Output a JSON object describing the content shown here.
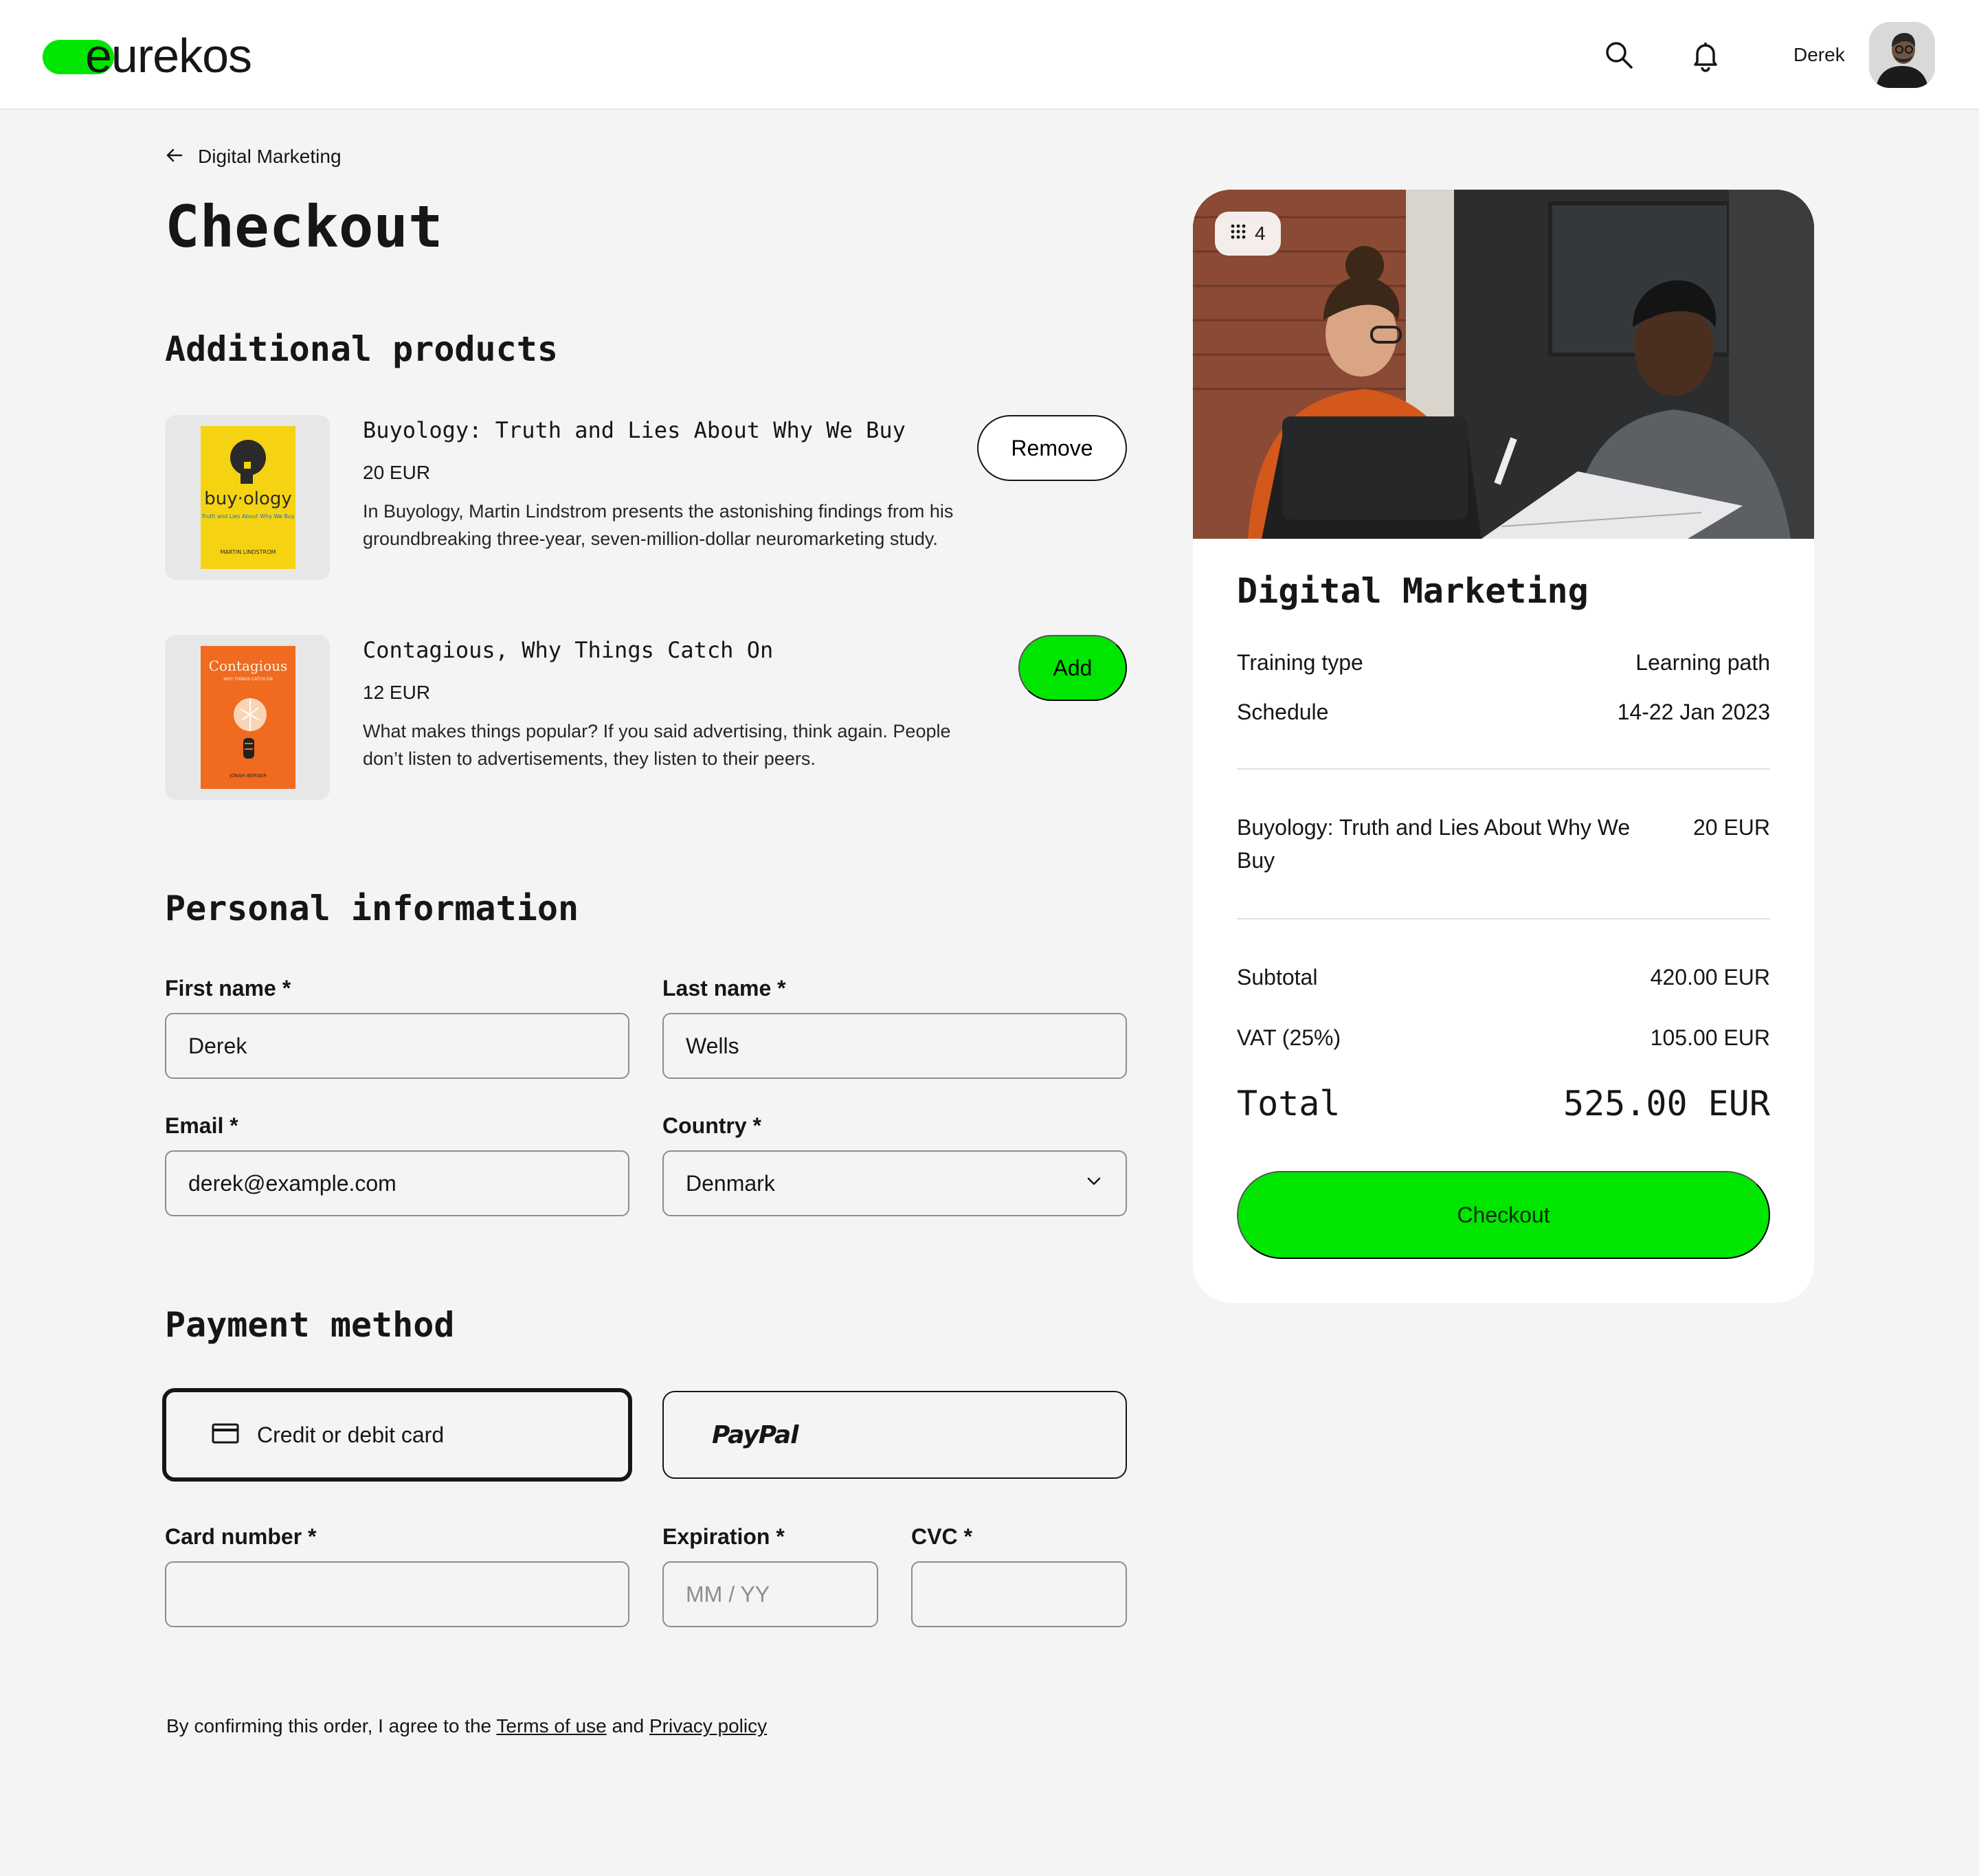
{
  "header": {
    "logo_text": "eurekos",
    "user_name": "Derek",
    "icons": [
      "search-icon",
      "bell-icon"
    ]
  },
  "breadcrumb": {
    "back_label": "Digital Marketing"
  },
  "page_title": "Checkout",
  "additional_products": {
    "title": "Additional products",
    "items": [
      {
        "name": "Buyology: Truth and Lies About Why We Buy",
        "price": "20 EUR",
        "description": "In Buyology, Martin Lindstrom presents the astonishing findings from his groundbreaking three-year, seven-million-dollar neuromarketing study.",
        "action": "Remove",
        "cover": {
          "title": "buy·ology",
          "subtitle": "Truth and Lies About Why We Buy",
          "author": "MARTIN LINDSTROM",
          "color": "#f5d313"
        }
      },
      {
        "name": "Contagious, Why Things Catch On",
        "price": "12 EUR",
        "description": "What makes things popular? If you said advertising, think again. People don’t listen to advertisements, they listen to their peers.",
        "action": "Add",
        "cover": {
          "title": "Contagious",
          "subtitle": "WHY THINGS CATCH ON",
          "author": "JONAH BERGER",
          "color": "#f06a1f"
        }
      }
    ]
  },
  "personal_information": {
    "title": "Personal information",
    "first_name": {
      "label": "First name *",
      "value": "Derek"
    },
    "last_name": {
      "label": "Last name *",
      "value": "Wells"
    },
    "email": {
      "label": "Email *",
      "value": "derek@example.com"
    },
    "country": {
      "label": "Country *",
      "value": "Denmark"
    }
  },
  "payment_method": {
    "title": "Payment method",
    "options": [
      "Credit or debit card",
      "PayPal"
    ],
    "selected": "Credit or debit card",
    "card_number": {
      "label": "Card number *",
      "value": "",
      "placeholder": ""
    },
    "expiration": {
      "label": "Expiration *",
      "value": "",
      "placeholder": "MM / YY"
    },
    "cvc": {
      "label": "CVC *",
      "value": "",
      "placeholder": ""
    }
  },
  "terms": {
    "prefix": "By confirming this order, I agree to the ",
    "terms_link": "Terms of use",
    "middle": " and ",
    "privacy_link": "Privacy policy"
  },
  "summary": {
    "image_badge": "4",
    "title": "Digital Marketing",
    "training_type_label": "Training type",
    "training_type_value": "Learning path",
    "schedule_label": "Schedule",
    "schedule_value": "14-22 Jan 2023",
    "line_item_name": "Buyology: Truth and Lies About Why We Buy",
    "line_item_price": "20 EUR",
    "subtotal_label": "Subtotal",
    "subtotal_value": "420.00 EUR",
    "vat_label": "VAT (25%)",
    "vat_value": "105.00 EUR",
    "total_label": "Total",
    "total_value": "525.00 EUR",
    "checkout_label": "Checkout"
  },
  "colors": {
    "accent": "#00e600",
    "background": "#f4f4f4",
    "text": "#161616"
  }
}
